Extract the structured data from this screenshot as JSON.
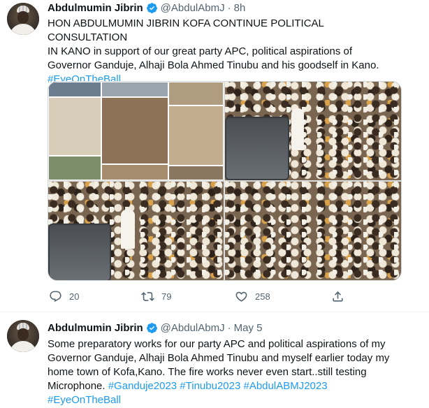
{
  "tweets": [
    {
      "author": {
        "name": "Abdulmumin Jibrin",
        "handle": "@AbdulAbmJ",
        "time": "8h",
        "verified": true
      },
      "text_lines": [
        "HON ABDULMUMIN JIBRIN KOFA CONTINUE POLITICAL CONSULTATION",
        "IN KANO in support of our great party APC, political aspirations of",
        "Governor Ganduje, Alhaji Bola Ahmed Tinubu and his goodself  in Kano."
      ],
      "hashtags_line": "#EyeOnTheBall",
      "media": [
        "collage",
        "crowd-truck",
        "crowd-car",
        "crowd-gathering"
      ],
      "stats": {
        "replies": "20",
        "retweets": "79",
        "likes": "258"
      }
    },
    {
      "author": {
        "name": "Abdulmumin Jibrin",
        "handle": "@AbdulAbmJ",
        "time": "May 5",
        "verified": true
      },
      "text_lines": [
        "Some preparatory works for our party APC and political aspirations of my",
        "Governor Ganduje, Alhaji Bola Ahmed Tinubu and myself earlier today my",
        "home town of Kofa,Kano. The fire works never even start..still testing"
      ],
      "mixed_line": {
        "prefix": "Microphone. ",
        "hashtags": "#Ganduje2023 #Tinubu2023 #AbdulABMJ2023"
      },
      "hashtags_line": "#EyeOnTheBall"
    }
  ],
  "separator": "·",
  "colors": {
    "link": "#1d9bf0",
    "secondary": "#536471",
    "verified": "#1d9bf0"
  },
  "icons": [
    "reply-icon",
    "retweet-icon",
    "like-icon",
    "share-icon",
    "verified-badge-icon"
  ]
}
